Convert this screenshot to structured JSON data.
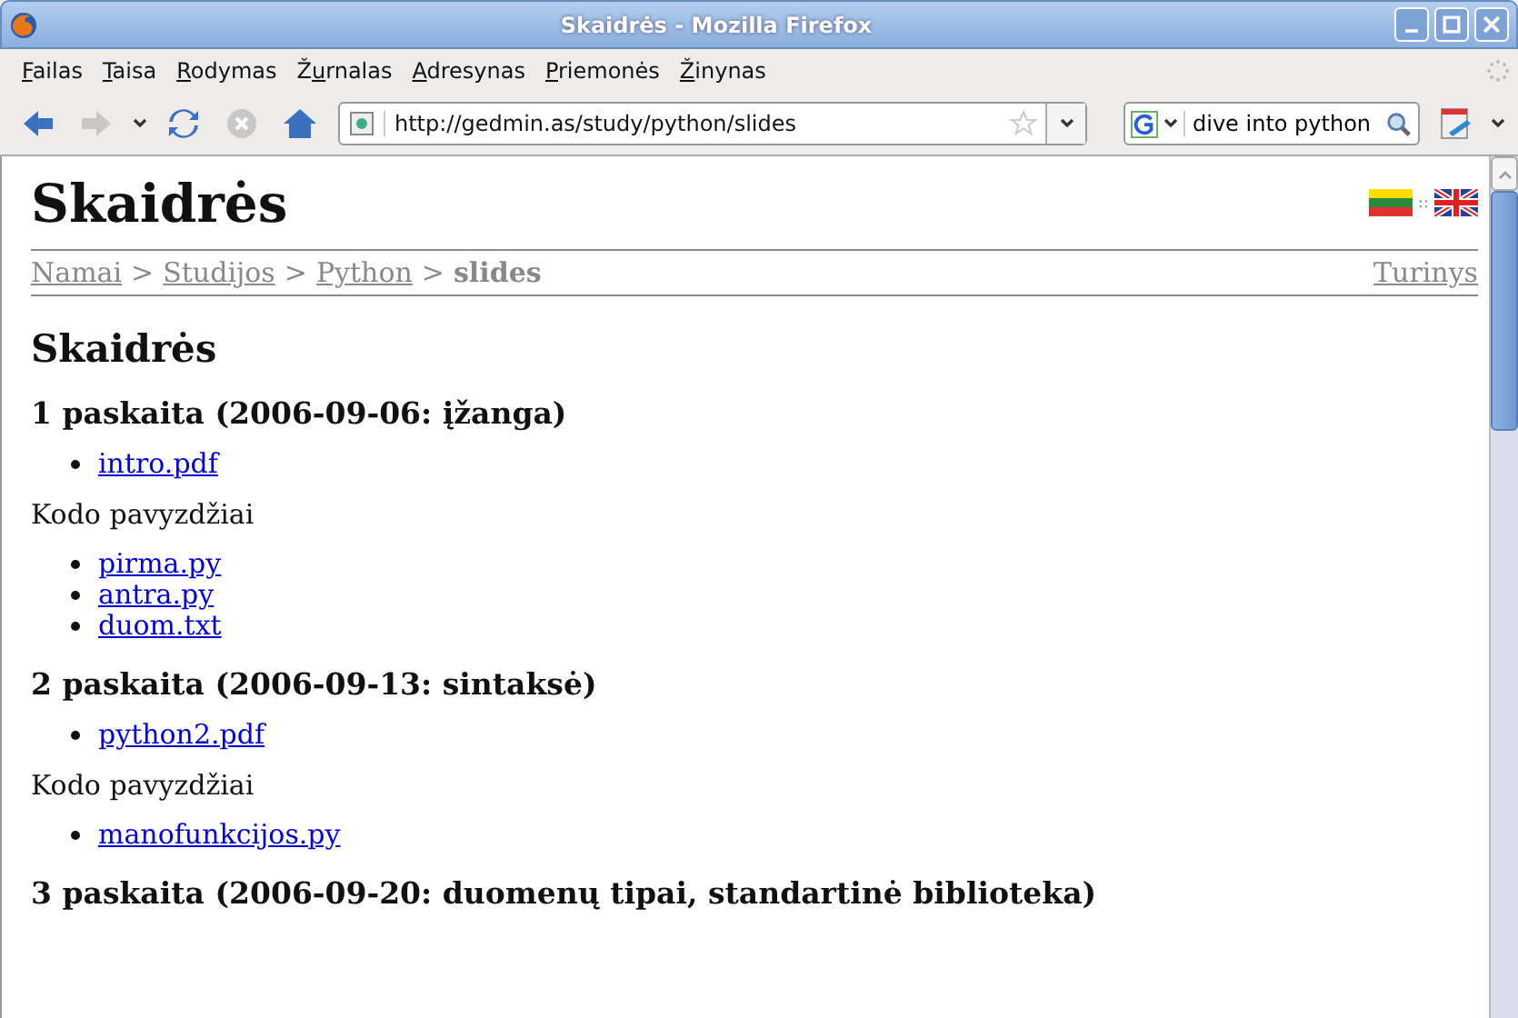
{
  "window": {
    "title": "Skaidrės - Mozilla Firefox"
  },
  "menu": [
    {
      "key": "F",
      "rest": "ailas"
    },
    {
      "key": "T",
      "rest": "aisa"
    },
    {
      "key": "R",
      "rest": "odymas"
    },
    {
      "lead": "Ž",
      "key": "u",
      "rest": "rnalas"
    },
    {
      "key": "A",
      "rest": "dresynas"
    },
    {
      "key": "P",
      "rest": "riemonės"
    },
    {
      "key": "Ž",
      "rest": "inynas"
    }
  ],
  "toolbar": {
    "back_disabled": false,
    "forward_disabled": true,
    "stop_disabled": true,
    "url": "http://gedmin.as/study/python/slides",
    "search": "dive into python"
  },
  "page": {
    "site_title": "Skaidrės",
    "breadcrumb": [
      {
        "label": "Namai",
        "kind": "link"
      },
      {
        "label": ">",
        "kind": "sep"
      },
      {
        "label": "Studijos",
        "kind": "link"
      },
      {
        "label": ">",
        "kind": "sep"
      },
      {
        "label": "Python",
        "kind": "link"
      },
      {
        "label": ">",
        "kind": "sep"
      },
      {
        "label": "slides",
        "kind": "current"
      }
    ],
    "contents_link": "Turinys",
    "lang_separator": "::",
    "heading": "Skaidrės",
    "lectures": [
      {
        "title": "1 paskaita (2006-09-06: įžanga)",
        "files": [
          "intro.pdf"
        ],
        "examples_label": "Kodo pavyzdžiai",
        "examples": [
          "pirma.py",
          "antra.py",
          "duom.txt"
        ]
      },
      {
        "title": "2 paskaita (2006-09-13: sintaksė)",
        "files": [
          "python2.pdf"
        ],
        "examples_label": "Kodo pavyzdžiai",
        "examples": [
          "manofunkcijos.py"
        ]
      },
      {
        "title": "3 paskaita (2006-09-20: duomenų tipai, standartinė biblioteka)"
      }
    ]
  }
}
